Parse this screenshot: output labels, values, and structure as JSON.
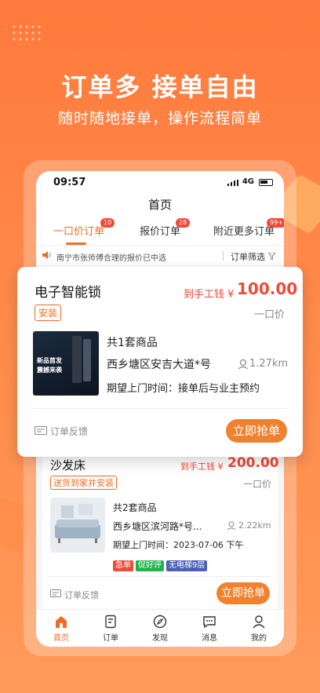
{
  "hero": {
    "title": "订单多 接单自由",
    "subtitle": "随时随地接单，操作流程简单"
  },
  "status_bar": {
    "time": "09:57",
    "network": "4G"
  },
  "nav": {
    "title": "首页"
  },
  "tabs": [
    {
      "label": "一口价订单",
      "badge": "10",
      "active": true
    },
    {
      "label": "报价订单",
      "badge": "28",
      "active": false
    },
    {
      "label": "附近更多订单",
      "badge": "99+",
      "active": false
    }
  ],
  "notice": {
    "text": "南宁市张师傅合理的报价已中选",
    "filter_label": "订单筛选"
  },
  "order1": {
    "title": "电子智能锁",
    "pay_label": "到手工钱 ¥",
    "pay_amount": "100.00",
    "tag": "安装",
    "price_type": "一口价",
    "goods": "共1套商品",
    "address": "西乡塘区安吉大道*号",
    "distance": "1.27km",
    "expect": "期望上门时间：接单后与业主预约",
    "feedback": "订单反馈",
    "grab": "立即抢单",
    "image_text_1": "新品首发",
    "image_text_2": "震撼来袭"
  },
  "order2": {
    "title": "沙发床",
    "pay_label": "到手工钱 ¥",
    "pay_amount": "200.00",
    "tag": "送货到家并安装",
    "price_type": "一口价",
    "goods": "共2套商品",
    "address": "西乡塘区滨河路*号...",
    "distance": "2.22km",
    "expect": "期望上门时间：2023-07-06 下午",
    "labels": [
      {
        "text": "急单",
        "color": "#ef4a3a"
      },
      {
        "text": "促好评",
        "color": "#22b24c"
      },
      {
        "text": "无电梯9层",
        "color": "#4a5fb8"
      }
    ],
    "feedback": "订单反馈",
    "grab": "立即抢单"
  },
  "tabbar": [
    {
      "label": "首页",
      "icon": "home-icon",
      "active": true
    },
    {
      "label": "订单",
      "icon": "order-icon",
      "active": false
    },
    {
      "label": "发现",
      "icon": "compass-icon",
      "active": false
    },
    {
      "label": "消息",
      "icon": "message-icon",
      "active": false
    },
    {
      "label": "我的",
      "icon": "user-icon",
      "active": false
    }
  ],
  "colors": {
    "brand": "#f26b21",
    "price": "#ef4a3a",
    "background": "#ff7a3c"
  }
}
